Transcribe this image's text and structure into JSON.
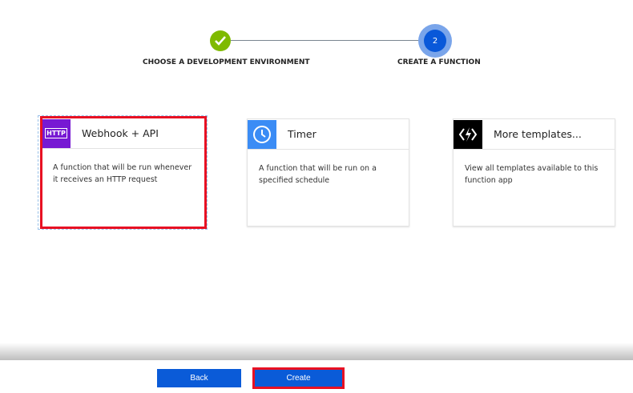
{
  "steps": [
    {
      "label": "CHOOSE A DEVELOPMENT ENVIRONMENT",
      "state": "complete"
    },
    {
      "label": "CREATE A FUNCTION",
      "number": "2",
      "state": "current"
    }
  ],
  "cards": [
    {
      "title": "Webhook + API",
      "icon_text": "HTTP",
      "description": "A function that will be run whenever it receives an HTTP request",
      "icon": "http-icon",
      "color": "#7719d3"
    },
    {
      "title": "Timer",
      "description": "A function that will be run on a specified schedule",
      "icon": "clock-icon",
      "color": "#3b8cf5"
    },
    {
      "title": "More templates...",
      "description": "View all templates available to this function app",
      "icon": "function-bolt-icon",
      "color": "#000000"
    }
  ],
  "footer": {
    "back": "Back",
    "create": "Create"
  }
}
